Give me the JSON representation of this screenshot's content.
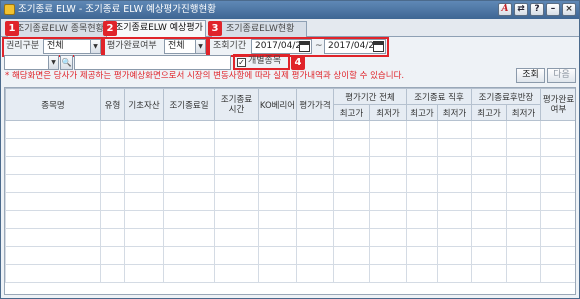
{
  "window": {
    "title": "조기종료 ELW - 조기종료 ELW 예상평가진행현황",
    "buttons": [
      {
        "name": "ascending-icon",
        "label": "A"
      },
      {
        "name": "link-icon",
        "label": "⇄"
      },
      {
        "name": "help-icon",
        "label": "?"
      },
      {
        "name": "minimize-icon",
        "label": "–"
      },
      {
        "name": "close-icon",
        "label": "×"
      }
    ]
  },
  "tabs": [
    {
      "label": "조기종료ELW 종목현황"
    },
    {
      "label": "조기종료ELW 예상평가"
    },
    {
      "label": "조기종료ELW현황"
    }
  ],
  "badges": [
    "1",
    "2",
    "3",
    "4"
  ],
  "filters": {
    "right_type_label": "권리구분",
    "right_type_value": "전체",
    "eval_done_label": "평가완료여부",
    "eval_done_value": "전체",
    "period_label": "조회기간",
    "date_from": "2017/04/20",
    "date_to": "2017/04/21",
    "tilde": "~",
    "individual_label": "개별종목",
    "individual_checked": "✓"
  },
  "notice": "* 해당화면은 당사가 제공하는 평가예상화면으로서 시장의 변동사항에 따라 실제 평가내역과 상이할 수 있습니다.",
  "actions": {
    "search": "조회",
    "next": "다음"
  },
  "grid": {
    "col_name": "종목명",
    "col_type": "유형",
    "col_base": "기초자산",
    "col_end_date": "조기종료일",
    "col_end_time": "조기종료\n시간",
    "col_ko": "KO베리어",
    "col_eval_price": "평가가격",
    "grp_eval_period": "평가기간 전체",
    "grp_after_end": "조기종료 직후",
    "grp_after_half": "조기종료후반장",
    "sub_high": "최고가",
    "sub_low": "최저가",
    "col_eval_done": "평가완료\n여부"
  }
}
